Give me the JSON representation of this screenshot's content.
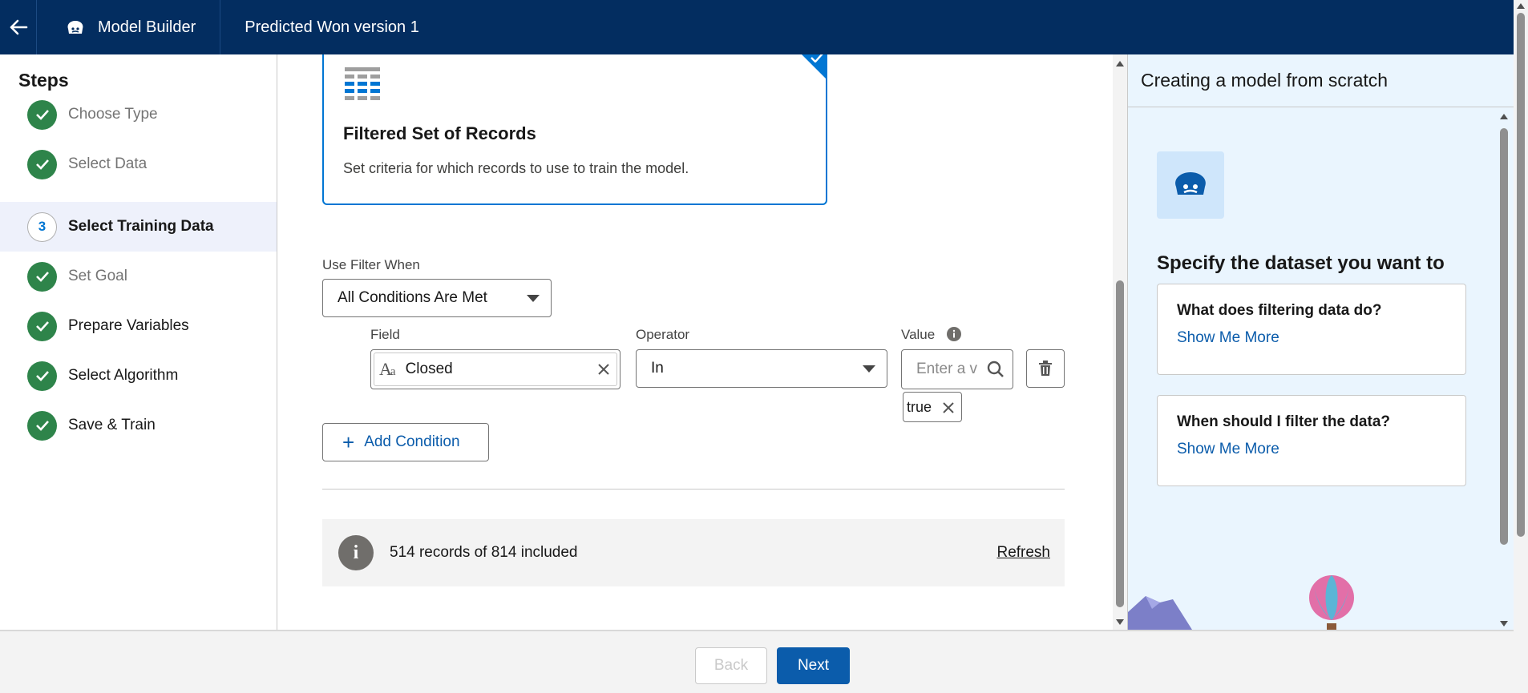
{
  "header": {
    "back_icon": "arrow-left-icon",
    "tool_icon": "einstein-icon",
    "tool_name": "Model Builder",
    "title": "Predicted Won version 1"
  },
  "steps": {
    "title": "Steps",
    "items": [
      {
        "label": "Choose Type",
        "state": "done"
      },
      {
        "label": "Select Data",
        "state": "done"
      },
      {
        "label": "Select Training Data",
        "state": "current",
        "number": "3"
      },
      {
        "label": "Set Goal",
        "state": "done"
      },
      {
        "label": "Prepare Variables",
        "state": "done"
      },
      {
        "label": "Select Algorithm",
        "state": "done"
      },
      {
        "label": "Save & Train",
        "state": "done"
      }
    ]
  },
  "main": {
    "card": {
      "title": "Filtered Set of Records",
      "description": "Set criteria for which records to use to train the model.",
      "selected": true
    },
    "use_filter": {
      "label": "Use Filter When",
      "value": "All Conditions Are Met"
    },
    "condition": {
      "field_label": "Field",
      "field_value": "Closed",
      "operator_label": "Operator",
      "operator_value": "In",
      "value_label": "Value",
      "value_placeholder": "Enter a v",
      "value_pill": "true"
    },
    "add_condition_label": "Add Condition",
    "records": {
      "text": "514 records of 814 included",
      "refresh_label": "Refresh"
    }
  },
  "help": {
    "title": "Creating a model from scratch",
    "heading": "Specify the dataset you want to use to train your predictive model.",
    "faqs": [
      {
        "question": "What does filtering data do?",
        "link": "Show Me More"
      },
      {
        "question": "When should I filter the data?",
        "link": "Show Me More"
      }
    ]
  },
  "footer": {
    "back_label": "Back",
    "next_label": "Next"
  },
  "colors": {
    "header_bg": "#032d60",
    "brand_blue": "#0176d3",
    "button_blue": "#0b5cab",
    "success_green": "#2e844a",
    "help_bg": "#eaf5fe"
  }
}
